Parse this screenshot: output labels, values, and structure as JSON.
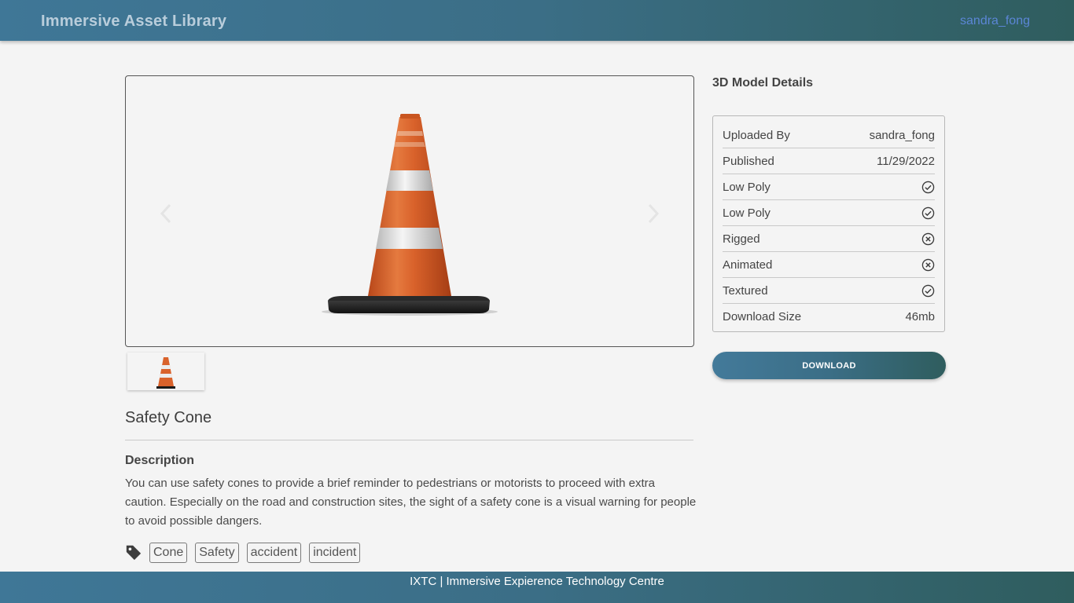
{
  "header": {
    "app_title": "Immersive Asset Library",
    "user": "sandra_fong"
  },
  "viewer": {
    "image": "traffic-cone",
    "prev_icon": "chevron-left-icon",
    "next_icon": "chevron-right-icon"
  },
  "asset": {
    "title": "Safety Cone",
    "description_heading": "Description",
    "description": "You can use safety cones to provide a brief reminder to pedestrians or motorists to proceed with extra caution. Especially on the road and construction sites, the sight of a safety cone is a visual warning for people to avoid possible dangers.",
    "tag_icon": "tag-icon",
    "tags": [
      "Cone",
      "Safety",
      "accident",
      "incident"
    ]
  },
  "details": {
    "heading": "3D Model Details",
    "rows": [
      {
        "label": "Uploaded By",
        "value": "sandra_fong"
      },
      {
        "label": "Published",
        "value": "11/29/2022"
      },
      {
        "label": "Low Poly",
        "icon": "check-circle-icon"
      },
      {
        "label": "Low Poly",
        "icon": "check-circle-icon"
      },
      {
        "label": "Rigged",
        "icon": "x-circle-icon"
      },
      {
        "label": "Animated",
        "icon": "x-circle-icon"
      },
      {
        "label": "Textured",
        "icon": "check-circle-icon"
      },
      {
        "label": "Download Size",
        "value": "46mb"
      }
    ],
    "download_label": "DOWNLOAD"
  },
  "footer": {
    "text": "IXTC | Immersive Expierence Technology Centre"
  },
  "colors": {
    "header_gradient_start": "#3f7797",
    "header_gradient_end": "#2f5d5e",
    "user_link": "#5b86d6",
    "cone_orange": "#d9622b"
  }
}
